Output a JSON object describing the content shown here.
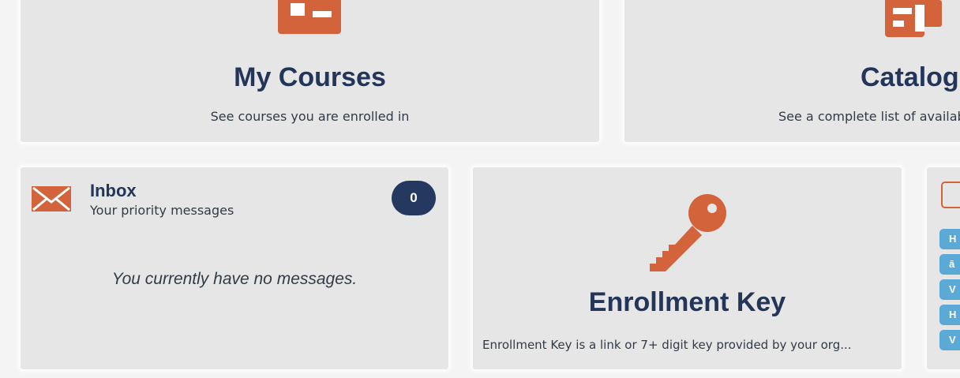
{
  "colors": {
    "accent": "#d2633a",
    "navy": "#233558",
    "badge": "#253860",
    "chip": "#5aa9d6",
    "tile": "#e6e6e6"
  },
  "my_courses": {
    "title": "My Courses",
    "subtitle": "See courses you are enrolled in",
    "icon": "id-card-icon"
  },
  "catalog": {
    "title": "Catalog",
    "subtitle": "See a complete list of available",
    "icon": "catalog-icon"
  },
  "inbox": {
    "title": "Inbox",
    "subtitle": "Your priority messages",
    "count": "0",
    "empty_message": "You currently have no messages.",
    "icon": "mail-icon"
  },
  "enrollment_key": {
    "title": "Enrollment Key",
    "description": "Enrollment Key is a link or 7+ digit key provided by your org...",
    "icon": "key-icon"
  },
  "third_tile": {
    "icon": "tag-icon",
    "chips": [
      "H",
      "ā",
      "V",
      "H",
      "V"
    ]
  }
}
